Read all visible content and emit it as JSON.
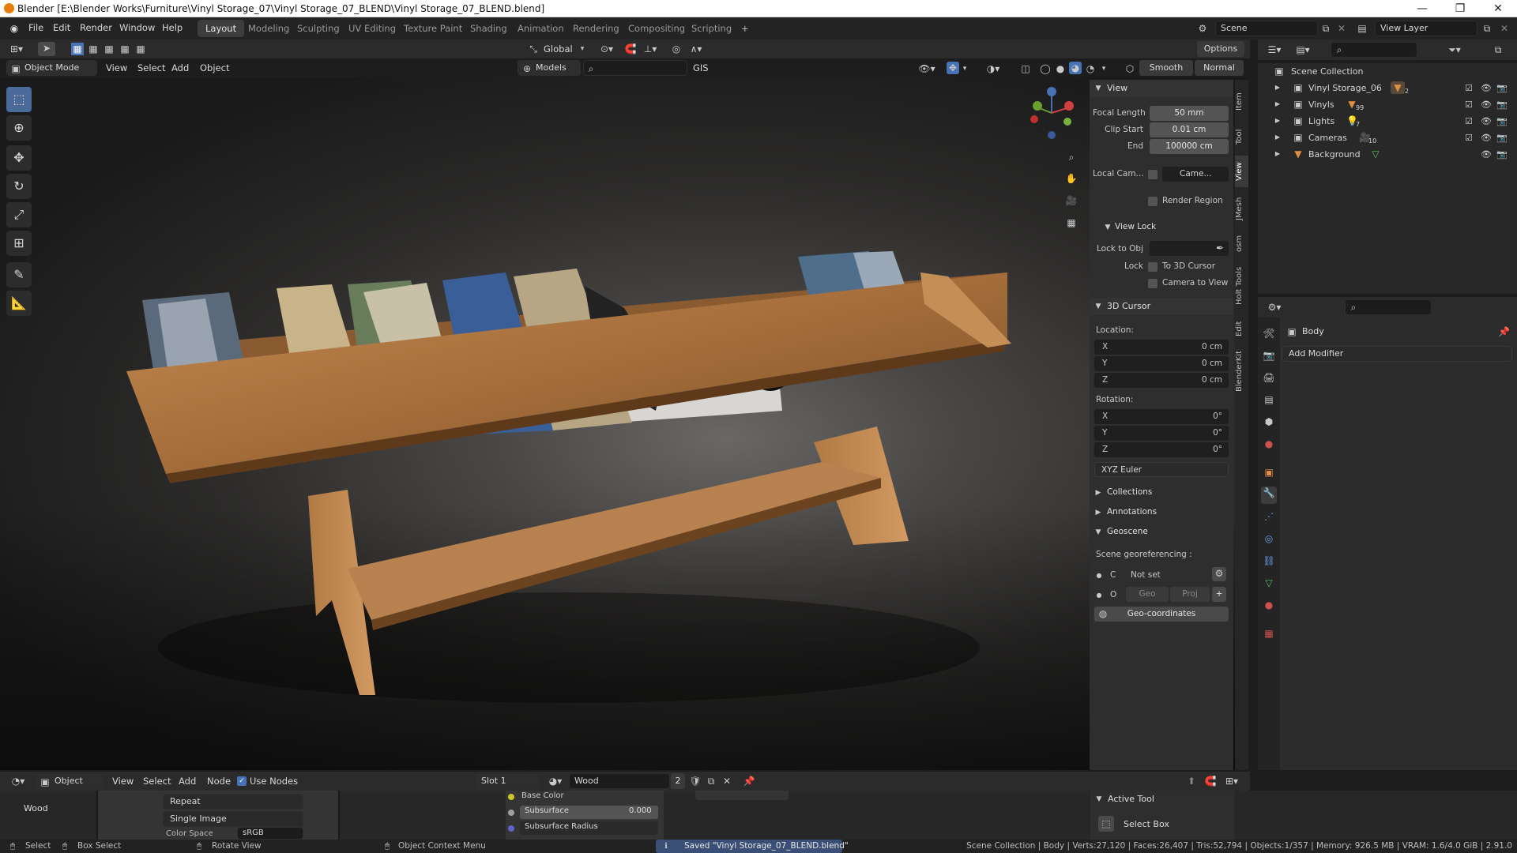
{
  "window": {
    "title": "Blender [E:\\Blender Works\\Furniture\\Vinyl Storage_07\\Vinyl Storage_07_BLEND\\Vinyl Storage_07_BLEND.blend]"
  },
  "menu": [
    "File",
    "Edit",
    "Render",
    "Window",
    "Help"
  ],
  "workspaces": [
    "Layout",
    "Modeling",
    "Sculpting",
    "UV Editing",
    "Texture Paint",
    "Shading",
    "Animation",
    "Rendering",
    "Compositing",
    "Scripting"
  ],
  "active_workspace": "Layout",
  "scene": {
    "scene_name": "Scene",
    "view_layer": "View Layer"
  },
  "viewport_header": {
    "mode": "Object Mode",
    "menus": [
      "View",
      "Select",
      "Add",
      "Object"
    ],
    "orientation": "Global",
    "models": "Models",
    "gis": "GIS",
    "options": "Options",
    "smooth": "Smooth",
    "normal": "Normal"
  },
  "npanel": {
    "view_title": "View",
    "focal_length_label": "Focal Length",
    "focal_length": "50 mm",
    "clip_start_label": "Clip Start",
    "clip_start": "0.01 cm",
    "end_label": "End",
    "end": "100000 cm",
    "local_cam_label": "Local Cam...",
    "local_cam_value": "Came...",
    "render_region": "Render Region",
    "view_lock_title": "View Lock",
    "lock_to_obj": "Lock to Obj",
    "lock_label": "Lock",
    "to_3d_cursor": "To 3D Cursor",
    "camera_to_view": "Camera to View",
    "cursor_title": "3D Cursor",
    "location_label": "Location:",
    "loc_x": "0 cm",
    "loc_y": "0 cm",
    "loc_z": "0 cm",
    "rotation_label": "Rotation:",
    "rot_x": "0°",
    "rot_y": "0°",
    "rot_z": "0°",
    "x": "X",
    "y": "Y",
    "z": "Z",
    "rotation_mode": "XYZ Euler",
    "collections": "Collections",
    "annotations": "Annotations",
    "geoscene": "Geoscene",
    "scene_georef": "Scene georeferencing :",
    "c_label": "C",
    "not_set": "Not set",
    "o_label": "O",
    "geo": "Geo",
    "proj": "Proj",
    "geo_coordinates": "Geo-coordinates",
    "tabs": [
      "Item",
      "Tool",
      "View",
      "JMesh",
      "osm",
      "Holt Tools",
      "Edit",
      "BlenderKit"
    ]
  },
  "outliner": {
    "root": "Scene Collection",
    "items": [
      {
        "name": "Vinyl Storage_06",
        "badge": "2"
      },
      {
        "name": "Vinyls",
        "badge": "99"
      },
      {
        "name": "Lights",
        "badge": "7"
      },
      {
        "name": "Cameras",
        "badge": "10"
      },
      {
        "name": "Background",
        "badge": ""
      }
    ]
  },
  "properties": {
    "object": "Body",
    "add_modifier": "Add Modifier"
  },
  "node_editor": {
    "mode": "Object",
    "menus": [
      "View",
      "Select",
      "Add",
      "Node"
    ],
    "use_nodes": "Use Nodes",
    "slot": "Slot 1",
    "material": "Wood",
    "users": "2",
    "image_node_label": "Wood",
    "repeat": "Repeat",
    "single_image": "Single Image",
    "color_space_label": "Color Space",
    "color_space": "sRGB",
    "base_color": "Base Color",
    "subsurface": "Subsurface",
    "subsurface_value": "0.000",
    "subsurface_radius": "Subsurface Radius",
    "active_tool_title": "Active Tool",
    "select_box": "Select Box"
  },
  "statusbar": {
    "select": "Select",
    "box_select": "Box Select",
    "rotate_view": "Rotate View",
    "context_menu": "Object Context Menu",
    "saved": "Saved \"Vinyl Storage_07_BLEND.blend\"",
    "stats": "Scene Collection | Body | Verts:27,120 | Faces:26,407 | Tris:52,794 | Objects:1/357 | Memory: 926.5 MB | VRAM: 1.6/4.0 GiB | 2.91.0"
  },
  "colors": {
    "accent": "#4772b3",
    "wood": "#b07a45",
    "background": "#1d1d1d"
  }
}
